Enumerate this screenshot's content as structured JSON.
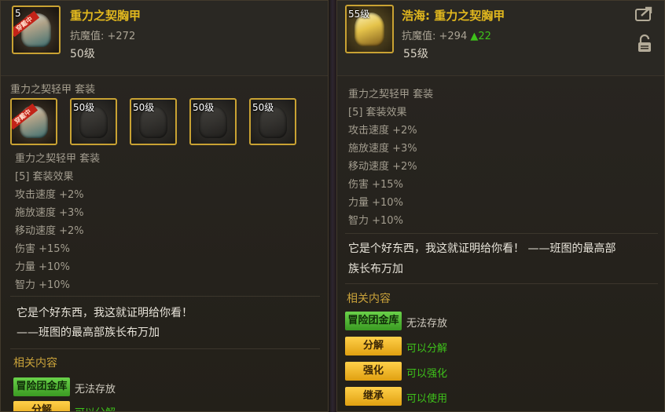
{
  "left": {
    "item": {
      "title": "重力之契胸甲",
      "stat": "抗魔值: +272",
      "level": "50级",
      "icon_tag": "5",
      "badge": "穿戴中"
    },
    "set_name": "重力之契轻甲 套装",
    "set_slots": [
      {
        "level": "",
        "badge": "穿戴中"
      },
      {
        "level": "50级",
        "badge": ""
      },
      {
        "level": "50级",
        "badge": ""
      },
      {
        "level": "50级",
        "badge": ""
      },
      {
        "level": "50级",
        "badge": ""
      }
    ],
    "set_lines": [
      "重力之契轻甲 套装",
      "[5] 套装效果",
      "攻击速度 +2%",
      "施放速度 +3%",
      "移动速度 +2%",
      "伤害 +15%",
      "力量 +10%",
      "智力 +10%"
    ],
    "flavor": [
      "它是个好东西，我这就证明给你看！",
      "——班图的最高部族长布万加"
    ],
    "related_title": "相关内容",
    "related": [
      {
        "button": "冒险团金库",
        "note": "无法存放",
        "color": "green"
      },
      {
        "button": "分解",
        "note": "可以分解",
        "color": "yellow"
      }
    ]
  },
  "right": {
    "item": {
      "title": "浩海: 重力之契胸甲",
      "stat_label": "抗魔值: +294",
      "stat_diff": "▲22",
      "level": "55级",
      "icon_tag": "55级"
    },
    "icons": {
      "share": "share-icon",
      "lock": "lock-icon"
    },
    "set_lines": [
      "重力之契轻甲 套装",
      "[5] 套装效果",
      "攻击速度 +2%",
      "施放速度 +3%",
      "移动速度 +2%",
      "伤害 +15%",
      "力量 +10%",
      "智力 +10%"
    ],
    "flavor": [
      "它是个好东西，我这就证明给你看！ ——班图的最高部",
      "族长布万加"
    ],
    "related_title": "相关内容",
    "related": [
      {
        "button": "冒险团金库",
        "note": "无法存放",
        "color": "green"
      },
      {
        "button": "分解",
        "note": "可以分解",
        "color": "yellow"
      },
      {
        "button": "强化",
        "note": "可以强化",
        "color": "yellow"
      },
      {
        "button": "继承",
        "note": "可以使用",
        "color": "yellow"
      }
    ]
  },
  "colors": {
    "title_gold": "#e2b81e",
    "green_plus": "#3ec21a",
    "button_yellow": "#ffd04a",
    "button_green": "#6ad24a"
  }
}
